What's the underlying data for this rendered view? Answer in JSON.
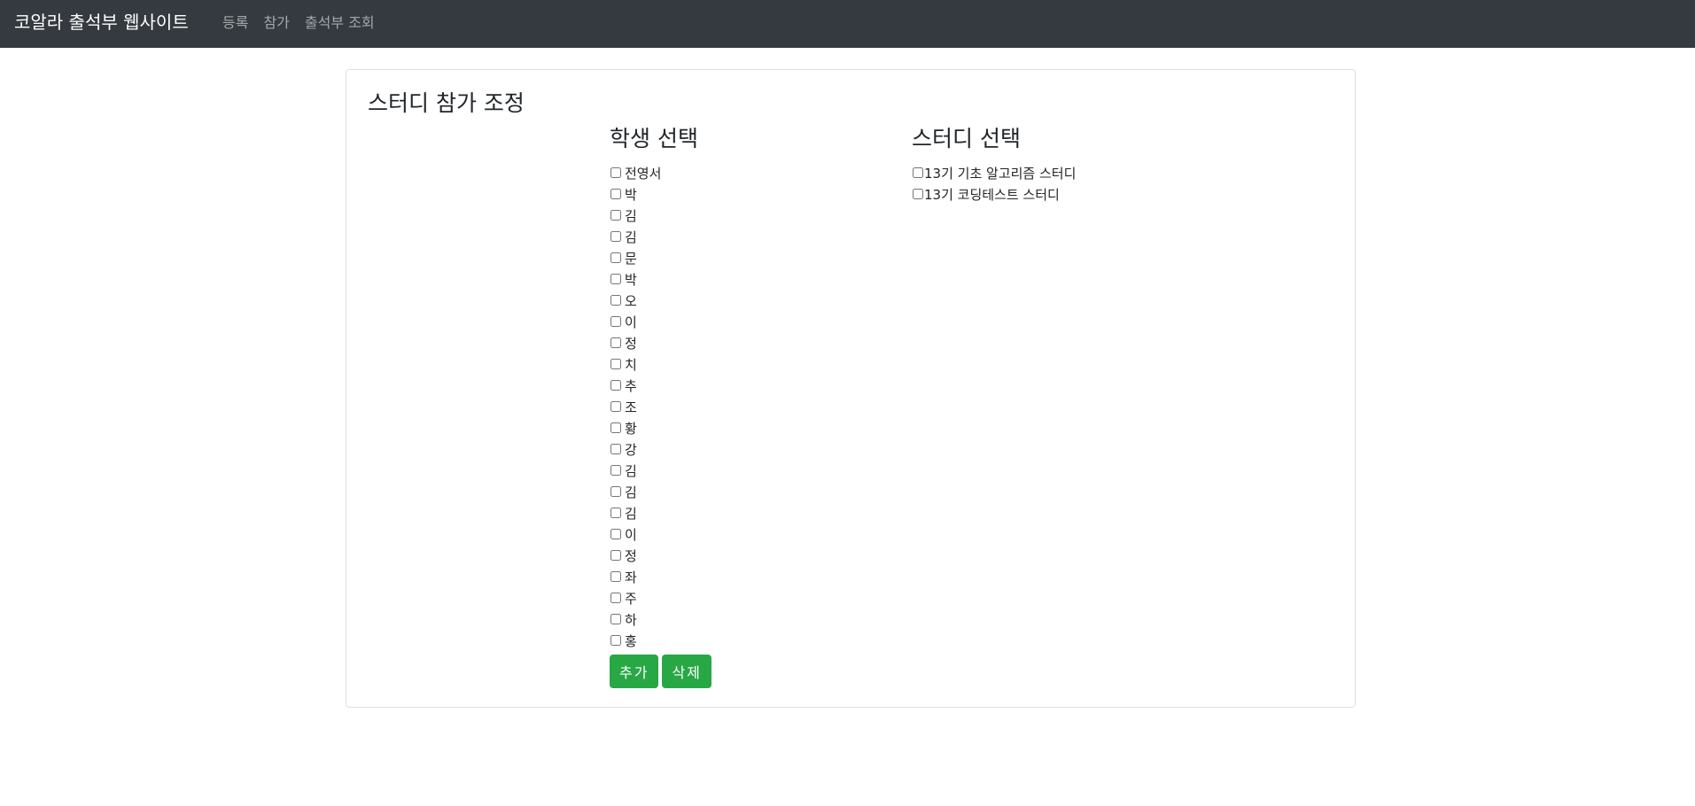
{
  "navbar": {
    "brand": "코알라 출석부 웹사이트",
    "links": [
      "등록",
      "참가",
      "출석부 조회"
    ]
  },
  "page": {
    "title": "스터디 참가 조정"
  },
  "students": {
    "heading": "학생 선택",
    "items": [
      "전영서",
      "박",
      "김",
      "김",
      "문",
      "박",
      "오",
      "이",
      "정",
      "치",
      "추",
      "조",
      "황",
      "강",
      "김",
      "김",
      "김",
      "이",
      "정",
      "좌",
      "주",
      "하",
      "홍"
    ]
  },
  "studies": {
    "heading": "스터디 선택",
    "items": [
      "13기 기초 알고리즘 스터디",
      "13기 코딩테스트 스터디"
    ]
  },
  "actions": {
    "add_label": "추가",
    "delete_label": "삭제"
  },
  "colors": {
    "navbar_bg": "#343a40",
    "button_bg": "#28a745"
  }
}
